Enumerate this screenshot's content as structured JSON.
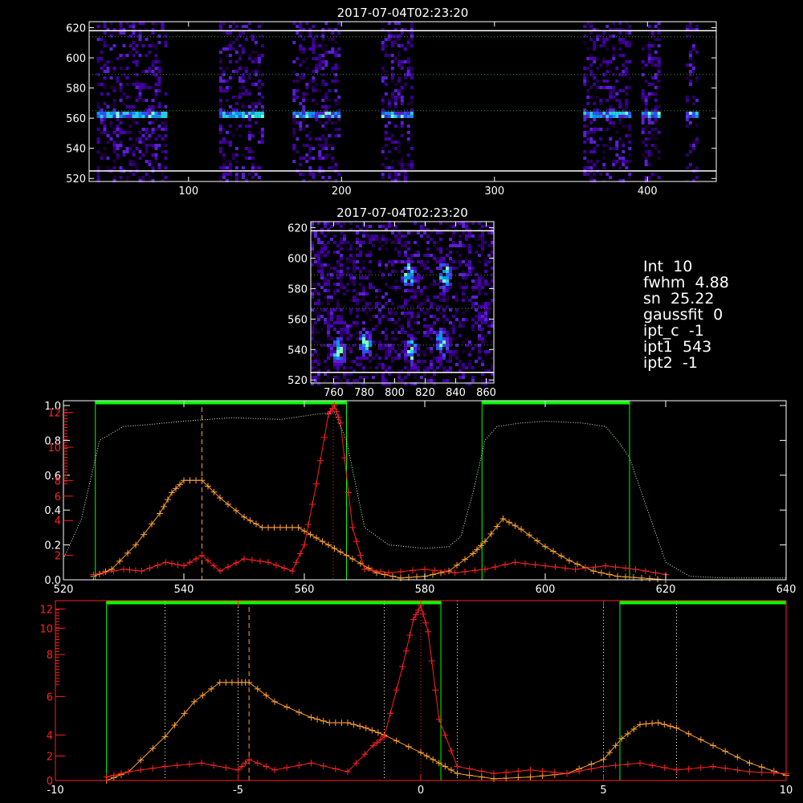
{
  "info_panel": [
    {
      "label": "Int",
      "value": "10"
    },
    {
      "label": "fwhm",
      "value": "4.88"
    },
    {
      "label": "sn",
      "value": "25.22"
    },
    {
      "label": "gaussfit",
      "value": "0"
    },
    {
      "label": "ipt_c",
      "value": "-1"
    },
    {
      "label": "ipt1",
      "value": "543"
    },
    {
      "label": "ipt2",
      "value": "-1"
    }
  ],
  "colors": {
    "background": "#000000",
    "axes": "#ffffff",
    "mask": "#00ff00",
    "orange_series": "#ffa030",
    "red_series": "#ff2020",
    "profile": "#ccffcc",
    "guide": "#33aa33"
  },
  "chart_data": [
    {
      "type": "heatmap",
      "title": "2017-07-04T02:23:20",
      "xlim": [
        35,
        445
      ],
      "ylim": [
        518,
        624
      ],
      "x_ticks": [
        "100",
        "200",
        "300",
        "400"
      ],
      "y_ticks": [
        "520",
        "540",
        "560",
        "580",
        "600",
        "620"
      ],
      "guide_lines_y": [
        565,
        589,
        614
      ],
      "white_lines_y": [
        525,
        618
      ],
      "bright_row_y": 564,
      "column_bands": [
        [
          40,
          85
        ],
        [
          120,
          148
        ],
        [
          168,
          198
        ],
        [
          226,
          245
        ],
        [
          358,
          388
        ],
        [
          396,
          408
        ],
        [
          425,
          432
        ]
      ]
    },
    {
      "type": "heatmap",
      "title": "2017-07-04T02:23:20",
      "xlim": [
        745,
        865
      ],
      "ylim": [
        518,
        624
      ],
      "x_ticks": [
        "760",
        "780",
        "800",
        "820",
        "840",
        "860"
      ],
      "y_ticks": [
        "520",
        "540",
        "560",
        "580",
        "600",
        "620"
      ],
      "guide_lines_y": [
        543,
        567,
        589
      ],
      "white_lines_y": [
        525,
        618
      ],
      "bright_spots": [
        [
          762,
          540
        ],
        [
          780,
          545
        ],
        [
          810,
          540
        ],
        [
          830,
          545
        ],
        [
          832,
          590
        ],
        [
          808,
          590
        ]
      ]
    },
    {
      "type": "line",
      "xlim": [
        520,
        640
      ],
      "x_ticks": [
        "520",
        "540",
        "560",
        "580",
        "600",
        "620",
        "640"
      ],
      "y_ticks_white": [
        "0.0",
        "0.2",
        "0.4",
        "0.6",
        "0.8",
        "1.0"
      ],
      "y_ticks_red": [
        "2",
        "4",
        "6",
        "8",
        "10",
        "12"
      ],
      "mask_ranges": [
        [
          525.3,
          567
        ],
        [
          589.5,
          614
        ]
      ],
      "vertical_line_orange_dashed": 543,
      "vertical_line_red_dotted": 564.8,
      "series": [
        {
          "color": "orange",
          "x": [
            525,
            528,
            532,
            536,
            538,
            540,
            543,
            546,
            550,
            553,
            556,
            559,
            562,
            565,
            568,
            572,
            576,
            580,
            584,
            588,
            590,
            593,
            596,
            600,
            604,
            608,
            612,
            616,
            620
          ],
          "y": [
            0.02,
            0.06,
            0.2,
            0.38,
            0.5,
            0.57,
            0.57,
            0.47,
            0.36,
            0.3,
            0.3,
            0.3,
            0.24,
            0.18,
            0.12,
            0.04,
            0.01,
            0.02,
            0.05,
            0.15,
            0.22,
            0.35,
            0.29,
            0.19,
            0.11,
            0.05,
            0.02,
            0.01,
            0.0
          ]
        },
        {
          "color": "red",
          "x": [
            525,
            530,
            533,
            537,
            540,
            543,
            546,
            550,
            554,
            558,
            560,
            562,
            564,
            565,
            566,
            568,
            570,
            574,
            580,
            585,
            590,
            595,
            600,
            605,
            610,
            615,
            620
          ],
          "y": [
            0.03,
            0.06,
            0.05,
            0.1,
            0.08,
            0.14,
            0.05,
            0.12,
            0.1,
            0.05,
            0.2,
            0.55,
            0.95,
            1.0,
            0.9,
            0.3,
            0.06,
            0.04,
            0.06,
            0.04,
            0.06,
            0.1,
            0.08,
            0.06,
            0.08,
            0.06,
            0.03
          ]
        },
        {
          "color": "profile",
          "x": [
            520,
            523,
            526,
            530,
            534,
            540,
            548,
            556,
            562,
            565,
            567,
            570,
            574,
            580,
            584,
            586,
            588,
            590,
            592,
            596,
            600,
            606,
            610,
            612,
            614,
            616,
            618,
            620,
            624,
            630,
            640
          ],
          "y": [
            0.12,
            0.35,
            0.8,
            0.88,
            0.89,
            0.91,
            0.93,
            0.92,
            0.95,
            0.96,
            0.8,
            0.3,
            0.2,
            0.18,
            0.19,
            0.25,
            0.5,
            0.8,
            0.88,
            0.9,
            0.91,
            0.9,
            0.88,
            0.8,
            0.7,
            0.5,
            0.3,
            0.1,
            0.02,
            0.01,
            0.01
          ]
        }
      ]
    },
    {
      "type": "line",
      "xlim": [
        -10,
        10
      ],
      "x_ticks": [
        "-10",
        "-5",
        "0",
        "5",
        "10"
      ],
      "y_ticks_red": [
        "0",
        "2",
        "4",
        "6",
        "8",
        "10",
        "12"
      ],
      "mask_ranges": [
        [
          -8.6,
          0.55
        ],
        [
          5.45,
          10
        ]
      ],
      "vertical_lines_dotted_white": [
        -7,
        -5,
        -1,
        1,
        5,
        7
      ],
      "vertical_line_orange_dashed": -4.7,
      "vertical_line_red_dotted": 0,
      "series": [
        {
          "color": "orange",
          "x": [
            -8.6,
            -8,
            -7,
            -6.2,
            -5.5,
            -5,
            -4.7,
            -4,
            -3,
            -2.5,
            -2,
            -1.5,
            -1,
            0,
            0.5,
            1,
            2,
            3,
            4,
            5,
            5.5,
            6,
            6.5,
            7,
            8,
            9,
            10
          ],
          "y": [
            0.0,
            0.05,
            0.25,
            0.45,
            0.56,
            0.56,
            0.56,
            0.45,
            0.36,
            0.33,
            0.33,
            0.3,
            0.26,
            0.16,
            0.1,
            0.04,
            0.01,
            0.02,
            0.04,
            0.12,
            0.24,
            0.32,
            0.33,
            0.3,
            0.2,
            0.1,
            0.03
          ]
        },
        {
          "color": "red",
          "x": [
            -8.6,
            -8,
            -7,
            -6,
            -5,
            -4.7,
            -4,
            -3,
            -2,
            -1.3,
            -1,
            -0.5,
            -0.2,
            0,
            0.2,
            0.5,
            1,
            2,
            3,
            4,
            5,
            6,
            7,
            8,
            9,
            10
          ],
          "y": [
            0.02,
            0.05,
            0.08,
            0.1,
            0.06,
            0.12,
            0.06,
            0.1,
            0.05,
            0.2,
            0.25,
            0.65,
            0.92,
            1.0,
            0.85,
            0.35,
            0.08,
            0.04,
            0.06,
            0.04,
            0.08,
            0.1,
            0.06,
            0.08,
            0.05,
            0.04
          ]
        }
      ]
    }
  ]
}
